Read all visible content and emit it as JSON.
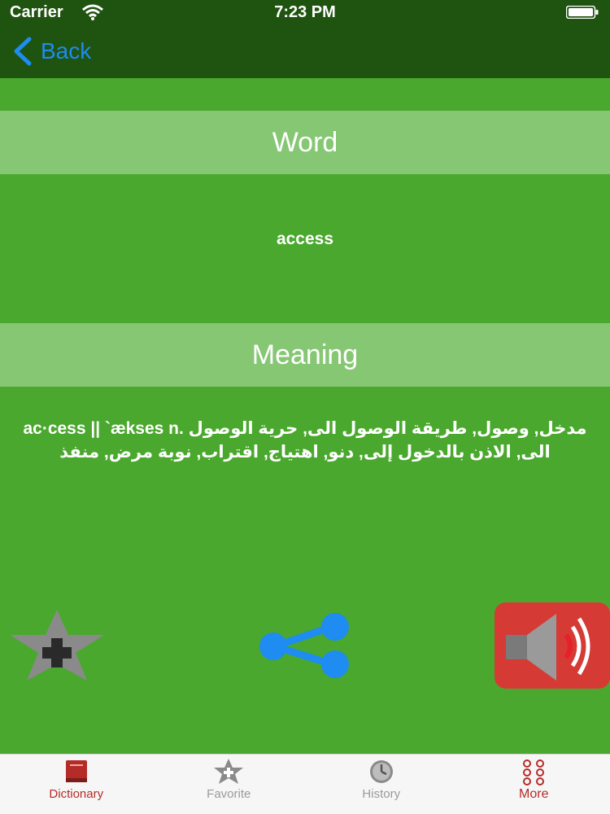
{
  "status_bar": {
    "carrier": "Carrier",
    "time": "7:23 PM",
    "wifi_icon": "wifi-icon",
    "battery_icon": "battery-icon"
  },
  "nav": {
    "back_label": "Back",
    "back_icon": "chevron-left-icon",
    "accent_color": "#1e8cf0"
  },
  "word_section": {
    "header": "Word",
    "value": "access"
  },
  "meaning_section": {
    "header": "Meaning",
    "value": "ac·cess || `ækses n. مدخل, وصول, طريقة الوصول الى, حرية الوصول الى, الاذن بالدخول إلى, دنو, اهتياج, اقتراب, نوبة مرض, منفذ"
  },
  "actions": {
    "favorite_icon": "star-plus-icon",
    "share_icon": "share-icon",
    "speaker_icon": "speaker-icon",
    "speaker_color": "#d63a35"
  },
  "tabs": [
    {
      "label": "Dictionary",
      "icon": "book-icon",
      "active": true
    },
    {
      "label": "Favorite",
      "icon": "star-plus-icon",
      "active": false
    },
    {
      "label": "History",
      "icon": "clock-icon",
      "active": false
    },
    {
      "label": "More",
      "icon": "grid-dots-icon",
      "active": false
    }
  ],
  "colors": {
    "background": "#4aa82e",
    "bar": "#1f5310",
    "section_header": "#86c774",
    "tab_active": "#b52b27"
  }
}
